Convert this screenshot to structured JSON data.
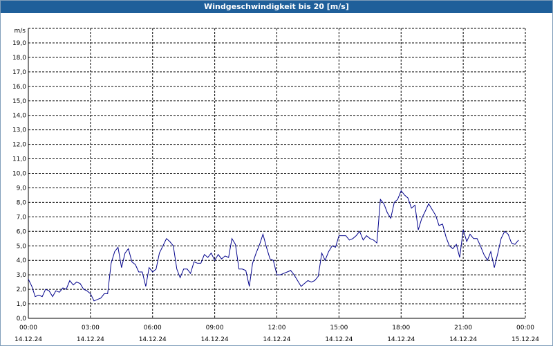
{
  "window": {
    "title": "Windgeschwindigkeit bis 20 [m/s]"
  },
  "colors": {
    "titlebar": "#1f5f9a",
    "line": "#00008b",
    "grid": "#000000"
  },
  "chart_data": {
    "type": "line",
    "title": "Windgeschwindigkeit bis 20 [m/s]",
    "ylabel": "m/s",
    "xlabel": "",
    "ylim": [
      0,
      20
    ],
    "grid": true,
    "y_ticks": [
      "0,0",
      "1,0",
      "2,0",
      "3,0",
      "4,0",
      "5,0",
      "6,0",
      "7,0",
      "8,0",
      "9,0",
      "10,0",
      "11,0",
      "12,0",
      "13,0",
      "14,0",
      "15,0",
      "16,0",
      "17,0",
      "18,0",
      "19,0"
    ],
    "x_ticks": [
      {
        "time": "00:00",
        "date": "14.12.24"
      },
      {
        "time": "03:00",
        "date": "14.12.24"
      },
      {
        "time": "06:00",
        "date": "14.12.24"
      },
      {
        "time": "09:00",
        "date": "14.12.24"
      },
      {
        "time": "12:00",
        "date": "14.12.24"
      },
      {
        "time": "15:00",
        "date": "14.12.24"
      },
      {
        "time": "18:00",
        "date": "14.12.24"
      },
      {
        "time": "21:00",
        "date": "14.12.24"
      },
      {
        "time": "00:00",
        "date": "15.12.24"
      }
    ],
    "xlim_hours": [
      0,
      24
    ],
    "series": [
      {
        "hours": [
          0.0,
          0.17,
          0.33,
          0.5,
          0.67,
          0.83,
          1.0,
          1.17,
          1.33,
          1.5,
          1.67,
          1.83,
          2.0,
          2.17,
          2.33,
          2.5,
          2.67,
          2.83,
          3.0,
          3.17,
          3.33,
          3.5,
          3.67,
          3.83,
          4.0,
          4.17,
          4.33,
          4.5,
          4.67,
          4.83,
          5.0,
          5.17,
          5.33,
          5.5,
          5.67,
          5.83,
          6.0,
          6.17,
          6.33,
          6.5,
          6.67,
          6.83,
          7.0,
          7.17,
          7.33,
          7.5,
          7.67,
          7.83,
          8.0,
          8.17,
          8.33,
          8.5,
          8.67,
          8.83,
          9.0,
          9.17,
          9.33,
          9.5,
          9.67,
          9.83,
          10.0,
          10.17,
          10.33,
          10.5,
          10.67,
          10.83,
          11.0,
          11.17,
          11.33,
          11.5,
          11.67,
          11.83,
          12.0,
          12.17,
          12.33,
          12.5,
          12.67,
          12.83,
          13.0,
          13.17,
          13.33,
          13.5,
          13.67,
          13.83,
          14.0,
          14.17,
          14.33,
          14.5,
          14.67,
          14.83,
          15.0,
          15.17,
          15.33,
          15.5,
          15.67,
          15.83,
          16.0,
          16.17,
          16.33,
          16.5,
          16.67,
          16.83,
          17.0,
          17.17,
          17.33,
          17.5,
          17.67,
          17.83,
          18.0,
          18.17,
          18.33,
          18.5,
          18.67,
          18.83,
          19.0,
          19.17,
          19.33,
          19.5,
          19.67,
          19.83,
          20.0,
          20.17,
          20.33,
          20.5,
          20.67,
          20.83,
          21.0,
          21.17,
          21.33,
          21.5,
          21.67,
          21.83,
          22.0,
          22.17,
          22.33,
          22.5,
          22.67,
          22.83,
          23.0,
          23.17,
          23.33,
          23.5,
          23.67
        ],
        "values": [
          2.7,
          2.2,
          1.5,
          1.6,
          1.5,
          2.0,
          1.9,
          1.5,
          1.9,
          1.8,
          2.1,
          2.0,
          2.6,
          2.3,
          2.5,
          2.4,
          2.0,
          1.9,
          1.7,
          1.2,
          1.3,
          1.4,
          1.7,
          1.7,
          3.8,
          4.6,
          4.9,
          3.5,
          4.5,
          4.8,
          3.9,
          3.7,
          3.2,
          3.2,
          2.2,
          3.5,
          3.2,
          3.4,
          4.5,
          5.0,
          5.5,
          5.3,
          5.0,
          3.4,
          2.8,
          3.4,
          3.4,
          3.1,
          3.9,
          3.8,
          3.8,
          4.4,
          4.2,
          4.5,
          4.0,
          4.4,
          4.1,
          4.3,
          4.2,
          5.5,
          5.1,
          3.4,
          3.4,
          3.3,
          2.2,
          3.8,
          4.5,
          5.1,
          5.8,
          4.9,
          4.1,
          4.0,
          3.0,
          3.0,
          3.1,
          3.2,
          3.3,
          3.0,
          2.6,
          2.2,
          2.4,
          2.6,
          2.5,
          2.6,
          2.9,
          4.5,
          4.0,
          4.6,
          5.0,
          4.9,
          5.7,
          5.7,
          5.7,
          5.4,
          5.5,
          5.7,
          6.0,
          5.4,
          5.7,
          5.5,
          5.4,
          5.2,
          8.2,
          7.9,
          7.3,
          6.9,
          8.0,
          8.2,
          8.8,
          8.5,
          8.3,
          7.6,
          7.8,
          6.1,
          6.9,
          7.4,
          7.9,
          7.5,
          7.1,
          6.4,
          6.5,
          5.6,
          5.0,
          4.8,
          5.1,
          4.2,
          6.1,
          5.3,
          5.8,
          5.5,
          5.5,
          5.0,
          4.4,
          4.0,
          4.6,
          3.5,
          4.5,
          5.5,
          6.0,
          5.8,
          5.2,
          5.1,
          5.4
        ]
      }
    ]
  }
}
